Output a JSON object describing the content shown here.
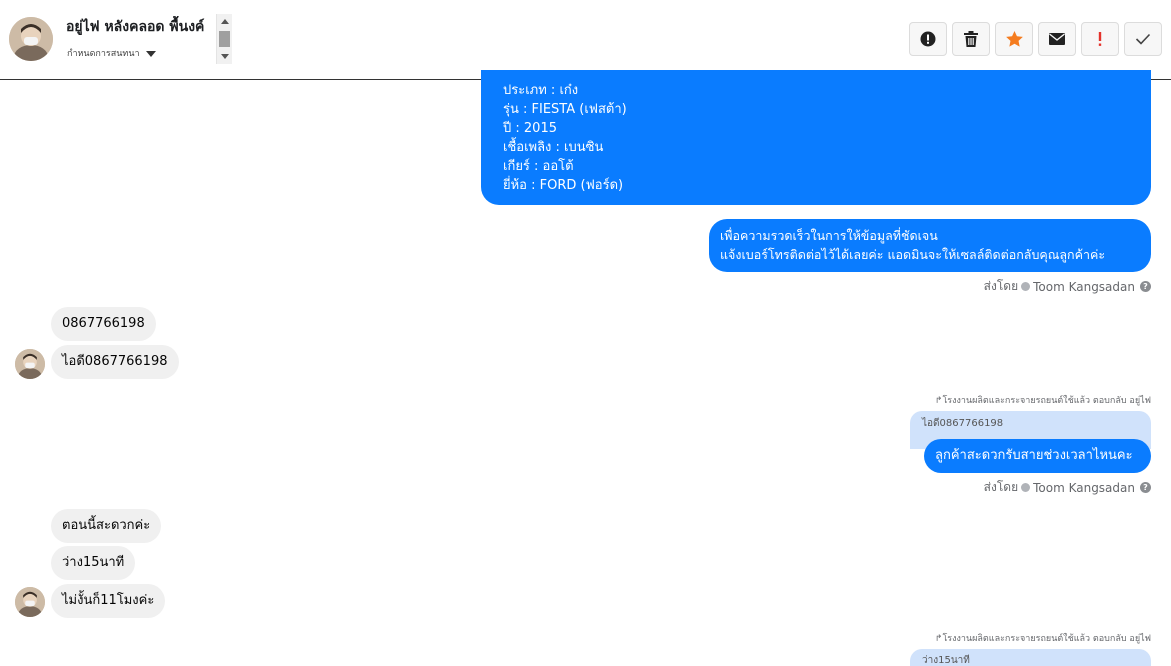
{
  "header": {
    "contact_name": "อยู่ไฟ หลังคลอด พื้นงค์",
    "subtitle": "กำหนดการสนทนา"
  },
  "actions": [
    {
      "name": "report-button",
      "icon": "exclamation-circle-icon"
    },
    {
      "name": "delete-button",
      "icon": "trash-icon"
    },
    {
      "name": "star-button",
      "icon": "star-icon"
    },
    {
      "name": "mail-button",
      "icon": "envelope-icon"
    },
    {
      "name": "important-button",
      "icon": "exclamation-icon"
    },
    {
      "name": "done-button",
      "icon": "check-icon"
    }
  ],
  "colors": {
    "outgoing_bubble": "#0a7cff",
    "incoming_bubble": "#f0f0f0",
    "quote_bubble": "#d0e2fb",
    "star": "#f57c1f",
    "alert": "#e4322b"
  },
  "messages": {
    "car_info": [
      "ประเภท : เก๋ง",
      "รุ่น : FIESTA (เฟสต้า)",
      "ปี : 2015",
      "เชื้อเพลิง : เบนซิน",
      "เกียร์ : ออโต้",
      "ยี่ห้อ : FORD (ฟอร์ด)"
    ],
    "request_phone": [
      "เพื่อความรวดเร็วในการให้ข้อมูลที่ชัดเจน",
      "แจ้งเบอร์โทรติดต่อไว้ได้เลยค่ะ แอดมินจะให้เซลล์ติดต่อกลับคุณลูกค้าค่ะ"
    ],
    "sent_by_1": "ส่งโดย",
    "agent_1": "Toom Kangsadan",
    "in_phone_1": "0867766198",
    "in_phone_2": "ไอดี0867766198",
    "reply_note_1": "โรงงานผลิตและกระจายรถยนต์ใช้แล้ว ตอบกลับ อยู่ไฟ",
    "quote_1": "ไอดี0867766198",
    "reply_1": "ลูกค้าสะดวกรับสายช่วงเวลาไหนคะ",
    "sent_by_2": "ส่งโดย",
    "agent_2": "Toom Kangsadan",
    "in_1": "ตอนนี้สะดวกค่ะ",
    "in_2": "ว่าง15นาที",
    "in_3": "ไม่งั้นก็11โมงค่ะ",
    "reply_note_2": "โรงงานผลิตและกระจายรถยนต์ใช้แล้ว ตอบกลับ อยู่ไฟ",
    "quote_2": "ว่าง15นาที"
  }
}
